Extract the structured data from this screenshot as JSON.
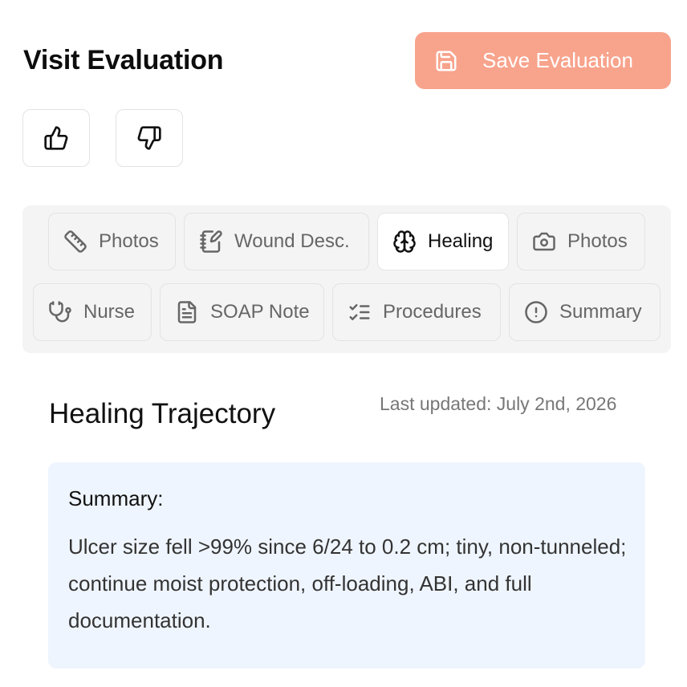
{
  "header": {
    "title": "Visit Evaluation",
    "save_label": "Save Evaluation",
    "save_color": "#f8a38c"
  },
  "feedback": {
    "thumbs_up_icon": "thumbs-up-icon",
    "thumbs_down_icon": "thumbs-down-icon"
  },
  "tabs": [
    {
      "label": "Photos",
      "icon": "ruler-icon",
      "active": false
    },
    {
      "label": "Wound Desc.",
      "icon": "notebook-pen-icon",
      "active": false
    },
    {
      "label": "Healing",
      "icon": "brain-icon",
      "active": true
    },
    {
      "label": "Photos",
      "icon": "camera-icon",
      "active": false
    },
    {
      "label": "Nurse",
      "icon": "stethoscope-icon",
      "active": false
    },
    {
      "label": "SOAP Note",
      "icon": "file-text-icon",
      "active": false
    },
    {
      "label": "Procedures",
      "icon": "list-checks-icon",
      "active": false
    },
    {
      "label": "Summary",
      "icon": "alert-circle-icon",
      "active": false
    }
  ],
  "content": {
    "title": "Healing Trajectory",
    "last_updated": "Last updated: July 2nd, 2026",
    "summary_label": "Summary:",
    "summary_text": "Ulcer size fell >99% since 6/24 to 0.2 cm; tiny, non-tunneled; continue moist protection, off-loading, ABI, and full documentation.",
    "summary_bg": "#eff5fe"
  }
}
